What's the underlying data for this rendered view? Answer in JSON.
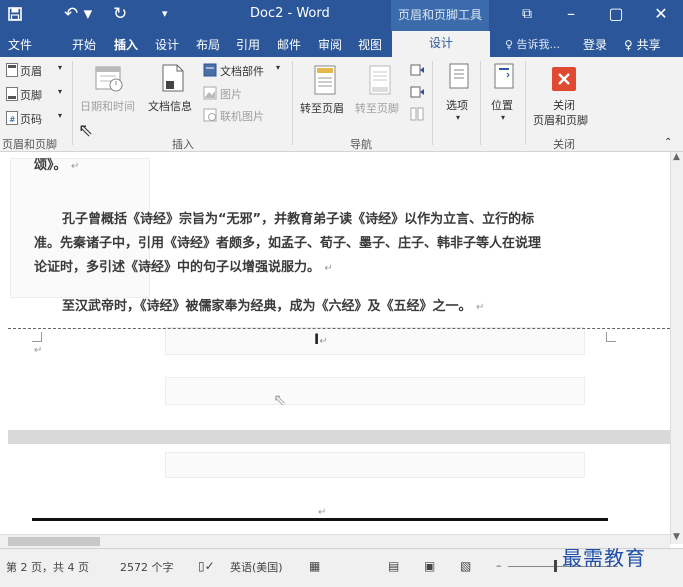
{
  "titlebar": {
    "doc_title": "Doc2 - Word",
    "context_title": "页眉和页脚工具",
    "qat": {
      "save": "💾",
      "undo": "↶ ▾",
      "redo": "↻",
      "customize": "▾"
    },
    "window": {
      "restore": "⧉",
      "minimize": "–",
      "maximize": "▢",
      "close": "✕"
    }
  },
  "tabs": {
    "file": "文件",
    "home": "开始",
    "insert": "插入",
    "design": "设计",
    "layout": "布局",
    "references": "引用",
    "mailings": "邮件",
    "review": "审阅",
    "view": "视图",
    "hf_design": "设计",
    "tell_me": "♀ 告诉我...",
    "signin": "登录",
    "share": "♀ 共享"
  },
  "ribbon": {
    "header": "页眉",
    "footer": "页脚",
    "page_number": "页码",
    "hf_group": "页眉和页脚",
    "date_time": "日期和时间",
    "doc_info": "文档信息",
    "doc_parts": "文档部件",
    "pictures": "图片",
    "online_pictures": "联机图片",
    "insert_group": "插入",
    "goto_header": "转至页眉",
    "goto_footer": "转至页脚",
    "nav_group": "导航",
    "options": "选项",
    "position": "位置",
    "close_line1": "关闭",
    "close_line2": "页眉和页脚",
    "close_group": "关闭"
  },
  "document": {
    "top_line": "颂》。",
    "para1_line1": "孔子曾概括《诗经》宗旨为“无邪”，并教育弟子读《诗经》以作为立言、立行的标",
    "para1_line2": "准。先秦诸子中，引用《诗经》者颇多，如孟子、荀子、墨子、庄子、韩非子等人在说理",
    "para1_line3": "论证时，多引述《诗经》中的句子以增强说服力。",
    "para2": "至汉武帝时，《诗经》被儒家奉为经典，成为《六经》及《五经》之一。"
  },
  "status": {
    "page": "第 2 页，共 4 页",
    "words": "2572 个字",
    "language": "英语(美国)"
  },
  "watermark": "最需教育",
  "colors": {
    "titlebar": "#2b579a",
    "ribbon": "#f2f2f2",
    "close_red": "#e04a32",
    "watermark": "#1f4fa8"
  }
}
